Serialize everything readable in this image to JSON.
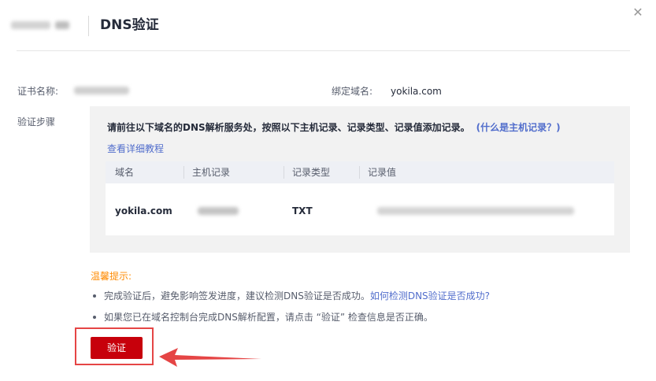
{
  "header": {
    "title": "DNS验证",
    "close_icon": "close-icon"
  },
  "cert_info": {
    "cert_name_label": "证书名称:",
    "domain_label": "绑定域名:",
    "domain_value": "yokila.com",
    "steps_label": "验证步骤"
  },
  "steps": {
    "instruction": "请前往以下域名的DNS解析服务处，按照以下主机记录、记录类型、记录值添加记录。",
    "help_link": "(什么是主机记录？)",
    "tutorial_link": "查看详细教程"
  },
  "table": {
    "columns": [
      "域名",
      "主机记录",
      "记录类型",
      "记录值"
    ],
    "rows": [
      {
        "domain": "yokila.com",
        "record_type": "TXT"
      }
    ]
  },
  "tips": {
    "title": "温馨提示:",
    "tip1_text": "完成验证后，避免影响签发进度，建议检测DNS验证是否成功。",
    "tip1_link": "如何检测DNS验证是否成功?",
    "tip2_text": "如果您已在域名控制台完成DNS解析配置，请点击 “验证” 检查信息是否正确。"
  },
  "actions": {
    "verify_label": "验证"
  },
  "colors": {
    "primary_button": "#c7000b",
    "link": "#526ecc",
    "warning": "#ff8a00",
    "annotation": "#e54545"
  }
}
